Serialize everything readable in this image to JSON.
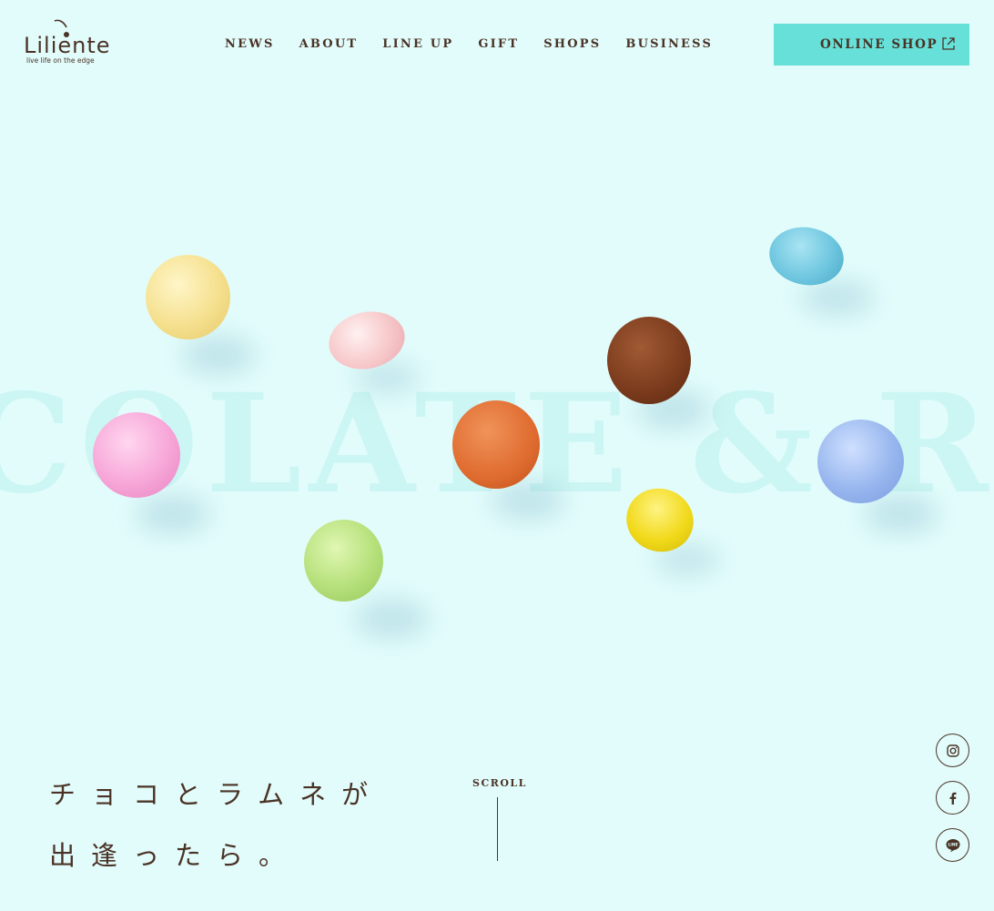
{
  "brand": {
    "name": "Liliente",
    "tagline": "live life on the edge"
  },
  "nav": {
    "items": [
      "NEWS",
      "ABOUT",
      "LINE UP",
      "GIFT",
      "SHOPS",
      "BUSINESS"
    ]
  },
  "online_shop": {
    "label": "ONLINE SHOP",
    "icon": "external-link-icon"
  },
  "hero": {
    "background_text": "COLATE & RAM",
    "catch_line1": "チョコとラムネが",
    "catch_line2": "出逢ったら。",
    "scroll_label": "SCROLL"
  },
  "social": {
    "icons": [
      "instagram-icon",
      "facebook-icon",
      "line-icon"
    ]
  },
  "colors": {
    "background": "#e2fcfb",
    "accent": "#66e0d8",
    "text": "#4a3326"
  }
}
